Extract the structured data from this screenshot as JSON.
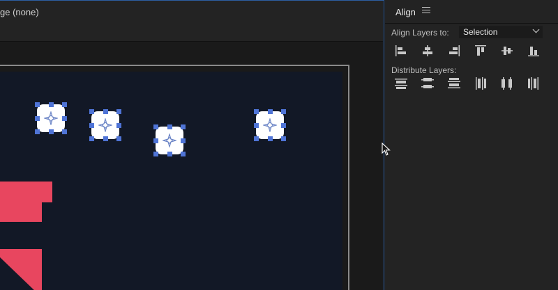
{
  "viewer": {
    "title": "ge (none)"
  },
  "align_panel": {
    "title": "Align",
    "align_layers_to_label": "Align Layers to:",
    "align_to_value": "Selection",
    "distribute_layers_label": "Distribute Layers:",
    "align_buttons": [
      "align-left-icon",
      "align-horizontal-center-icon",
      "align-right-icon",
      "align-top-icon",
      "align-vertical-center-icon",
      "align-bottom-icon"
    ],
    "distribute_buttons": [
      "distribute-top-icon",
      "distribute-vertical-center-icon",
      "distribute-bottom-icon",
      "distribute-left-icon",
      "distribute-horizontal-center-icon",
      "distribute-right-icon"
    ]
  },
  "colors": {
    "accent_border": "#2d5fa3",
    "composition_bg": "#121826",
    "shape_red": "#e8465f",
    "handle_blue": "#4f74d6"
  }
}
